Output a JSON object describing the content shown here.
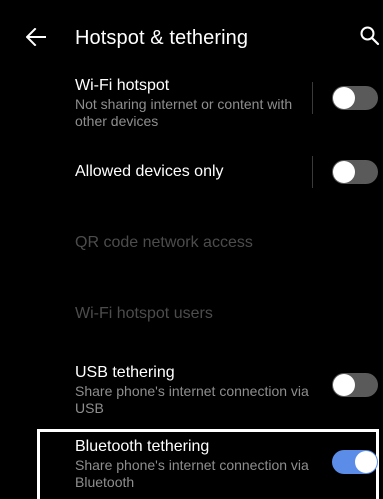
{
  "header": {
    "title": "Hotspot & tethering",
    "back_icon": "arrow-left-icon",
    "search_icon": "search-icon"
  },
  "items": [
    {
      "title": "Wi-Fi hotspot",
      "summary": "Not sharing internet or content with other devices",
      "switch_on": false
    },
    {
      "title": "Allowed devices only",
      "switch_on": false
    },
    {
      "title": "QR code network access",
      "disabled": true
    },
    {
      "title": "Wi-Fi hotspot users",
      "disabled": true
    },
    {
      "title": "USB tethering",
      "summary": "Share phone's internet connection via USB",
      "switch_on": false
    },
    {
      "title": "Bluetooth tethering",
      "summary": "Share phone's internet connection via Bluetooth",
      "switch_on": true
    }
  ],
  "colors": {
    "background": "#000000",
    "switch_on_track": "#5b8de8",
    "switch_off_track": "#5a5a5a",
    "summary_text": "#8e8e8e",
    "disabled_text": "#4c4c4c"
  }
}
